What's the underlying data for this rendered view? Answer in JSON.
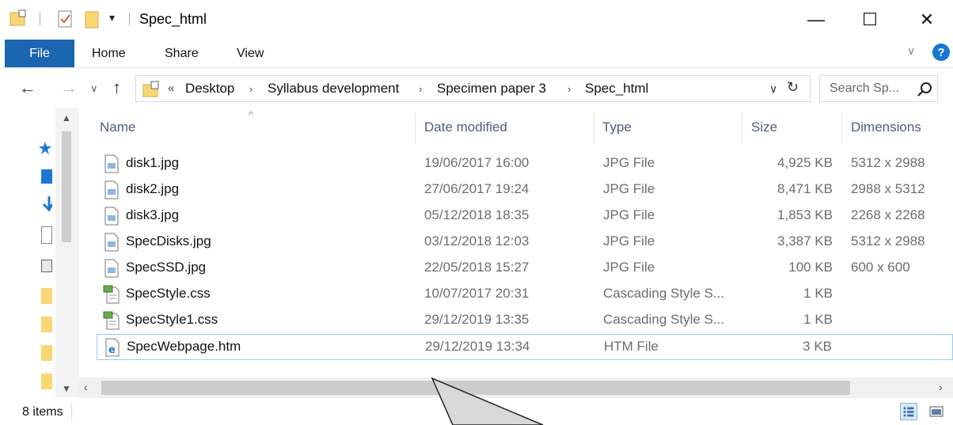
{
  "window": {
    "title": "Spec_html",
    "controls": {
      "minimize": "—",
      "maximize": "☐",
      "close": "✕"
    }
  },
  "ribbon": {
    "file": "File",
    "tabs": [
      "Home",
      "Share",
      "View"
    ],
    "help": "?"
  },
  "address": {
    "overflow": "«",
    "crumbs": [
      "Desktop",
      "Syllabus development",
      "Specimen paper 3",
      "Spec_html"
    ]
  },
  "search": {
    "placeholder": "Search Sp..."
  },
  "columns": {
    "name": "Name",
    "date": "Date modified",
    "type": "Type",
    "size": "Size",
    "dimensions": "Dimensions"
  },
  "files": [
    {
      "name": "disk1.jpg",
      "date": "19/06/2017 16:00",
      "type": "JPG File",
      "size": "4,925 KB",
      "dimensions": "5312 x 2988",
      "icon": "image-file-icon"
    },
    {
      "name": "disk2.jpg",
      "date": "27/06/2017 19:24",
      "type": "JPG File",
      "size": "8,471 KB",
      "dimensions": "2988 x 5312",
      "icon": "image-file-icon"
    },
    {
      "name": "disk3.jpg",
      "date": "05/12/2018 18:35",
      "type": "JPG File",
      "size": "1,853 KB",
      "dimensions": "2268 x 2268",
      "icon": "image-file-icon"
    },
    {
      "name": "SpecDisks.jpg",
      "date": "03/12/2018 12:03",
      "type": "JPG File",
      "size": "3,387 KB",
      "dimensions": "5312 x 2988",
      "icon": "image-file-icon"
    },
    {
      "name": "SpecSSD.jpg",
      "date": "22/05/2018 15:27",
      "type": "JPG File",
      "size": "100 KB",
      "dimensions": "600 x 600",
      "icon": "image-file-icon"
    },
    {
      "name": "SpecStyle.css",
      "date": "10/07/2017 20:31",
      "type": "Cascading Style S...",
      "size": "1 KB",
      "dimensions": "",
      "icon": "css-file-icon"
    },
    {
      "name": "SpecStyle1.css",
      "date": "29/12/2019 13:35",
      "type": "Cascading Style S...",
      "size": "1 KB",
      "dimensions": "",
      "icon": "css-file-icon"
    },
    {
      "name": "SpecWebpage.htm",
      "date": "29/12/2019 13:34",
      "type": "HTM File",
      "size": "3 KB",
      "dimensions": "",
      "icon": "html-file-icon"
    }
  ],
  "status": {
    "items": "8 items"
  },
  "colors": {
    "accent": "#1b66b0",
    "selection_border": "#99c9ef",
    "header_text": "#4c607a"
  }
}
